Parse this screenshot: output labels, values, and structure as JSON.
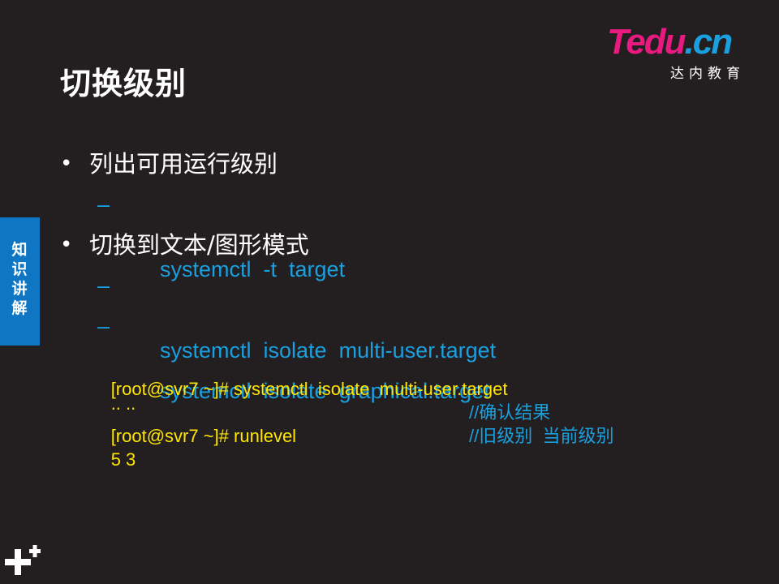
{
  "slide": {
    "title": "切换级别",
    "logo": {
      "brand_t": "T",
      "brand_edu": "edu",
      "brand_dot": ".",
      "brand_cn": "cn",
      "subtitle": "达内教育"
    },
    "side_tab": {
      "line1": "知",
      "line2": "识",
      "line3": "讲",
      "line4": "解"
    },
    "bullets": [
      {
        "marker": "•",
        "text": "列出可用运行级别",
        "sub": [
          {
            "marker": "–",
            "text": "systemctl  -t  target"
          }
        ]
      },
      {
        "marker": "•",
        "text": "切换到文本/图形模式",
        "sub": [
          {
            "marker": "–",
            "text": "systemctl  isolate  multi-user.target"
          },
          {
            "marker": "–",
            "text": "systemctl  isolate  graphical.target"
          }
        ]
      }
    ],
    "terminal": {
      "lines": [
        {
          "text": "[root@svr7 ~]# systemctl  isolate  multi-user.target",
          "comment": ""
        },
        {
          "text": ".. ..",
          "comment": ""
        },
        {
          "text": "[root@svr7 ~]# runlevel",
          "comment": "//确认结果"
        },
        {
          "text": "5 3",
          "comment": "//旧级别  当前级别"
        }
      ]
    },
    "icons": {
      "corner": "plus-icon"
    },
    "colors": {
      "background": "#231f20",
      "accent_blue": "#1a9fdf",
      "terminal_yellow": "#ffe500",
      "tab_blue": "#0e76c2",
      "brand_pink": "#e8197f"
    }
  }
}
